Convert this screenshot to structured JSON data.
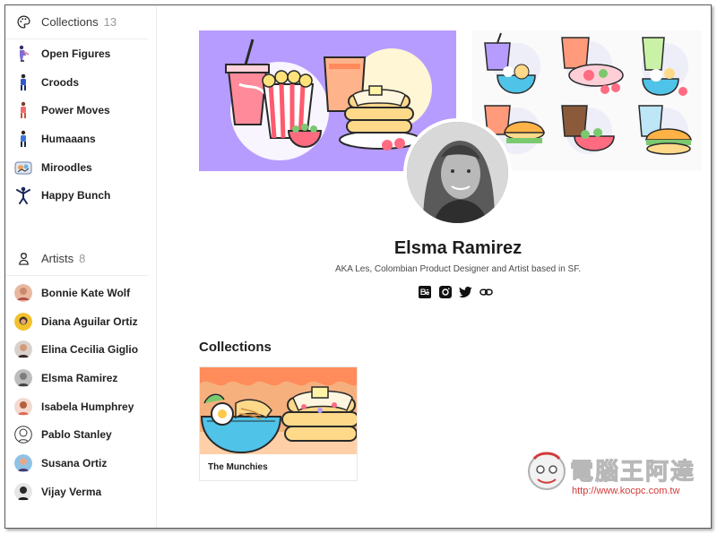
{
  "sidebar": {
    "collections": {
      "title": "Collections",
      "count": "13",
      "icon": "palette-icon",
      "items": [
        {
          "label": "Open Figures",
          "icon": "open-figures-icon"
        },
        {
          "label": "Croods",
          "icon": "croods-icon"
        },
        {
          "label": "Power Moves",
          "icon": "power-moves-icon"
        },
        {
          "label": "Humaaans",
          "icon": "humaaans-icon"
        },
        {
          "label": "Miroodles",
          "icon": "miroodles-icon"
        },
        {
          "label": "Happy Bunch",
          "icon": "happy-bunch-icon"
        }
      ]
    },
    "artists": {
      "title": "Artists",
      "count": "8",
      "icon": "artist-icon",
      "items": [
        {
          "label": "Bonnie Kate Wolf"
        },
        {
          "label": "Diana Aguilar Ortiz"
        },
        {
          "label": "Elina Cecilia Giglio"
        },
        {
          "label": "Elsma Ramirez"
        },
        {
          "label": "Isabela Humphrey"
        },
        {
          "label": "Pablo Stanley"
        },
        {
          "label": "Susana Ortiz"
        },
        {
          "label": "Vijay Verma"
        }
      ]
    }
  },
  "profile": {
    "name": "Elsma Ramirez",
    "bio": "AKA Les, Colombian Product Designer and Artist based in SF.",
    "socials": [
      "behance-icon",
      "instagram-icon",
      "twitter-icon",
      "link-icon"
    ]
  },
  "collections_section": {
    "title": "Collections",
    "cards": [
      {
        "title": "The Munchies"
      }
    ]
  },
  "watermark": {
    "text": "電腦王阿達",
    "url": "http://www.kocpc.com.tw"
  },
  "colors": {
    "banner_purple": "#b79cff",
    "card_orange": "#f6b07e",
    "accent_red": "#d23a3a"
  }
}
